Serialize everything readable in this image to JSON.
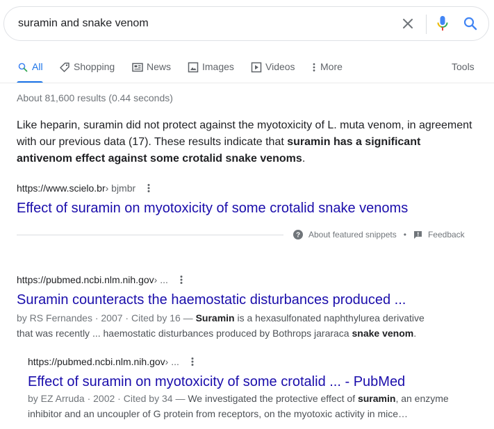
{
  "search": {
    "query": "suramin and snake venom"
  },
  "tabs": [
    {
      "label": "All",
      "icon": "search-icon",
      "active": true
    },
    {
      "label": "Shopping",
      "icon": "tag-icon"
    },
    {
      "label": "News",
      "icon": "news-icon"
    },
    {
      "label": "Images",
      "icon": "image-icon"
    },
    {
      "label": "Videos",
      "icon": "video-icon"
    },
    {
      "label": "More",
      "icon": "more-vert-icon"
    },
    {
      "label": "Tools"
    }
  ],
  "stats": "About 81,600 results (0.44 seconds)",
  "featured_snippet": {
    "text_1": "Like heparin, suramin did not protect against the myotoxicity of L. muta venom, in agreement with our previous data (17). These results indicate that ",
    "text_bold": "suramin has a significant antivenom effect against some crotalid snake venoms",
    "text_2": ".",
    "url": "https://www.scielo.br",
    "crumb": " › bjmbr",
    "title": "Effect of suramin on myotoxicity of some crotalid snake venoms",
    "about_label": "About featured snippets",
    "separator": "•",
    "feedback_label": "Feedback"
  },
  "results": [
    {
      "url": "https://pubmed.ncbi.nlm.nih.gov",
      "crumb": " › ...",
      "title": "Suramin counteracts the haemostatic disturbances produced ...",
      "meta": "by RS Fernandes · 2007 · Cited by 16 — ",
      "desc_1_bold": "Suramin",
      "desc_2": " is a hexasulfonated naphthylurea derivative that was recently ... haemostatic disturbances produced by Bothrops jararaca ",
      "desc_3_bold": "snake venom",
      "desc_4": "."
    },
    {
      "url": "https://pubmed.ncbi.nlm.nih.gov",
      "crumb": " › ...",
      "title": "Effect of suramin on myotoxicity of some crotalid ... - PubMed",
      "meta": "by EZ Arruda · 2002 · Cited by 34 — ",
      "desc_1": "We investigated the protective effect of ",
      "desc_2_bold": "suramin",
      "desc_3": ", an enzyme inhibitor and an uncoupler of G protein from receptors, on the myotoxic activity in mice…"
    }
  ],
  "colors": {
    "accent": "#1a73e8",
    "link": "#1a0dab",
    "mic_blue": "#4285f4",
    "mic_red": "#ea4335",
    "mic_yellow": "#fbbc04",
    "mic_green": "#34a853"
  }
}
